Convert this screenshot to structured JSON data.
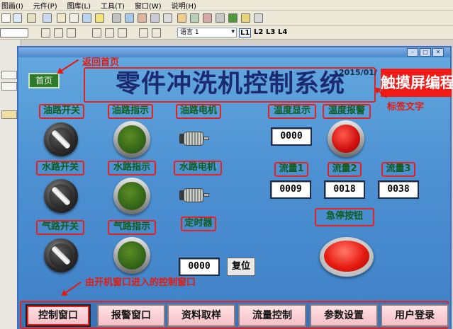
{
  "editor": {
    "menus": [
      "图画(I)",
      "元件(P)",
      "图库(L)",
      "工具(T)",
      "窗口(W)",
      "说明(H)"
    ],
    "language_select": "语言 1",
    "levels": [
      "L1",
      "L2",
      "L3",
      "L4"
    ]
  },
  "hmi": {
    "home_label": "首页",
    "title": "零件冲洗机控制系统",
    "date_text": "2015/01/",
    "brand_label": "触摸屏编程",
    "labels": {
      "oil_switch": "油路开关",
      "oil_indicator": "油路指示",
      "oil_motor": "油路电机",
      "water_switch": "水路开关",
      "water_indicator": "水路指示",
      "water_motor": "水路电机",
      "gas_switch": "气路开关",
      "gas_indicator": "气路指示",
      "timer": "定时器",
      "temp_display": "温度显示",
      "temp_alarm": "温度报警",
      "flow1": "流量1",
      "flow2": "流量2",
      "flow3": "流量3",
      "estop": "急停按钮"
    },
    "values": {
      "temperature": "0000",
      "flow1": "0009",
      "flow2": "0018",
      "flow3": "0038",
      "timer": "0000"
    },
    "reset_label": "复位",
    "nav": [
      "控制窗口",
      "报警窗口",
      "资料取样",
      "流量控制",
      "参数设置",
      "用户登录"
    ]
  },
  "annotations": {
    "home": "返回首页",
    "label_text": "标签文字",
    "entry_window": "由开机窗口进入的控制窗口"
  },
  "colors": {
    "annotation": "#e31a10",
    "indicator_green": "#2f5f16",
    "alarm_red": "#d00f0f",
    "brand_red": "#f21a16"
  }
}
